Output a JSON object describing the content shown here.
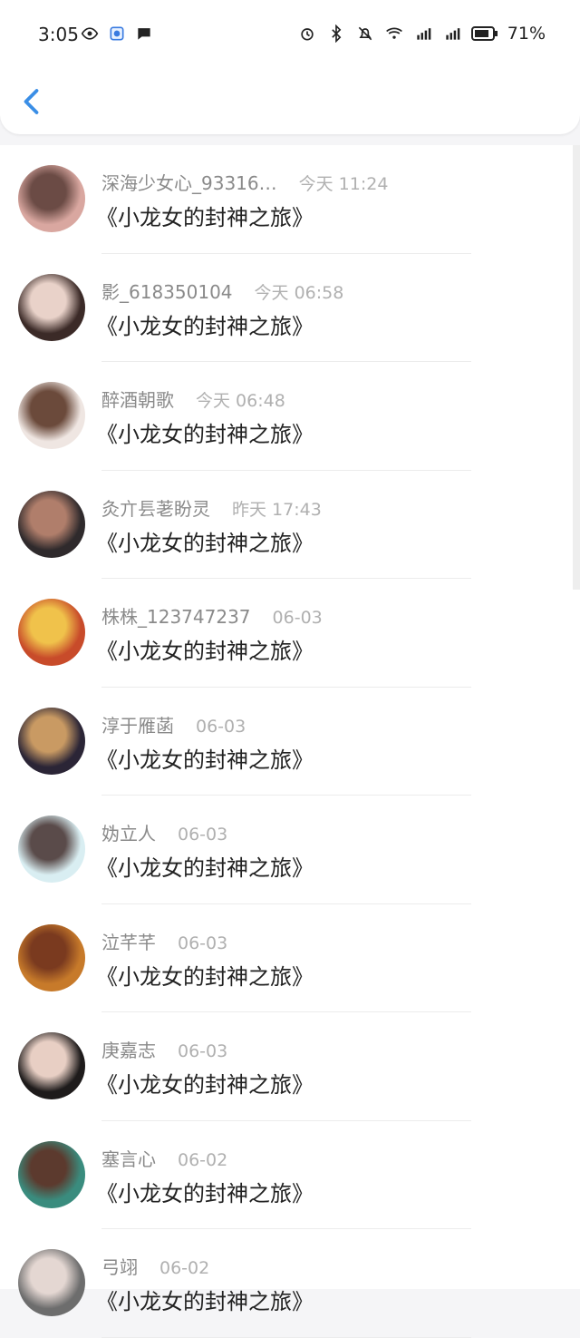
{
  "status": {
    "time": "3:05",
    "battery": "71%"
  },
  "list": [
    {
      "name": "深海少女心_93316…",
      "time": "今天 11:24",
      "title": "《小龙女的封神之旅》",
      "avatar_colors": [
        "#d9a7a0",
        "#6b4b45"
      ]
    },
    {
      "name": "影_618350104",
      "time": "今天 06:58",
      "title": "《小龙女的封神之旅》",
      "avatar_colors": [
        "#3b2a27",
        "#e9d2c9"
      ]
    },
    {
      "name": "醉酒朝歌",
      "time": "今天 06:48",
      "title": "《小龙女的封神之旅》",
      "avatar_colors": [
        "#efe6e2",
        "#6b4a3b"
      ]
    },
    {
      "name": "灸亣镸荖盼灵",
      "time": "昨天 17:43",
      "title": "《小龙女的封神之旅》",
      "avatar_colors": [
        "#2f2a2c",
        "#b07e6b"
      ]
    },
    {
      "name": "株株_123747237",
      "time": "06-03",
      "title": "《小龙女的封神之旅》",
      "avatar_colors": [
        "#c84b2a",
        "#f0c24b"
      ]
    },
    {
      "name": "淳于雁菡",
      "time": "06-03",
      "title": "《小龙女的封神之旅》",
      "avatar_colors": [
        "#2b2536",
        "#c99a63"
      ]
    },
    {
      "name": "妫立人",
      "time": "06-03",
      "title": "《小龙女的封神之旅》",
      "avatar_colors": [
        "#d9eef2",
        "#5a4b4a"
      ]
    },
    {
      "name": "泣芊芊",
      "time": "06-03",
      "title": "《小龙女的封神之旅》",
      "avatar_colors": [
        "#c77a2a",
        "#7a3a1f"
      ]
    },
    {
      "name": "庚嘉志",
      "time": "06-03",
      "title": "《小龙女的封神之旅》",
      "avatar_colors": [
        "#1e1b1b",
        "#e8cfc4"
      ]
    },
    {
      "name": "塞言心",
      "time": "06-02",
      "title": "《小龙女的封神之旅》",
      "avatar_colors": [
        "#3a8c7e",
        "#5c3a2e"
      ]
    },
    {
      "name": "弓翊",
      "time": "06-02",
      "title": "《小龙女的封神之旅》",
      "avatar_colors": [
        "#6d6d6d",
        "#e4d7d2"
      ]
    }
  ]
}
